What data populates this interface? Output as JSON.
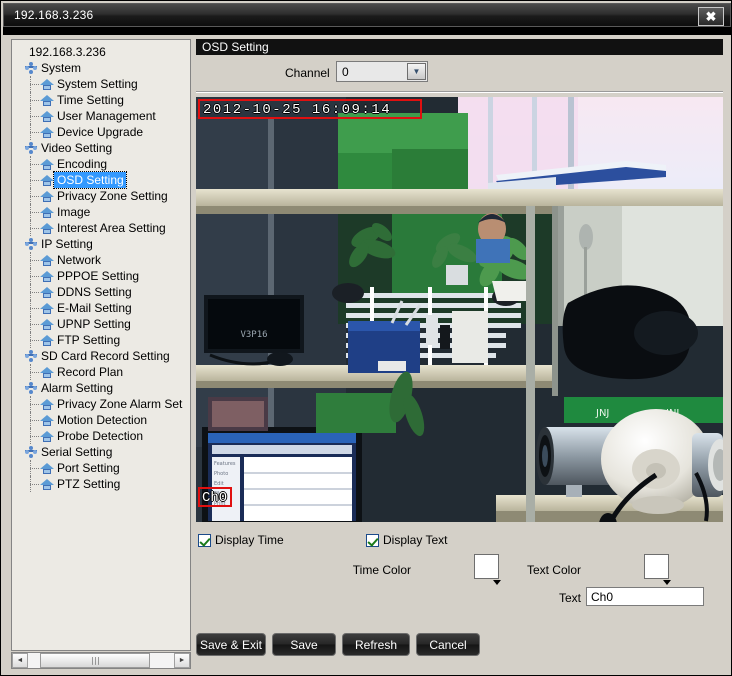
{
  "window": {
    "title": "192.168.3.236",
    "close_label": "✖"
  },
  "tree": {
    "root_label": "192.168.3.236",
    "nodes": [
      {
        "label": "System",
        "level": 1,
        "type": "group"
      },
      {
        "label": "System Setting",
        "level": 2,
        "type": "item"
      },
      {
        "label": "Time Setting",
        "level": 2,
        "type": "item"
      },
      {
        "label": "User Management",
        "level": 2,
        "type": "item"
      },
      {
        "label": "Device Upgrade",
        "level": 2,
        "type": "item"
      },
      {
        "label": "Video Setting",
        "level": 1,
        "type": "group"
      },
      {
        "label": "Encoding",
        "level": 2,
        "type": "item"
      },
      {
        "label": "OSD Setting",
        "level": 2,
        "type": "item",
        "selected": true
      },
      {
        "label": "Privacy Zone Setting",
        "level": 2,
        "type": "item"
      },
      {
        "label": "Image",
        "level": 2,
        "type": "item"
      },
      {
        "label": "Interest Area Setting",
        "level": 2,
        "type": "item"
      },
      {
        "label": "IP Setting",
        "level": 1,
        "type": "group"
      },
      {
        "label": "Network",
        "level": 2,
        "type": "item"
      },
      {
        "label": "PPPOE Setting",
        "level": 2,
        "type": "item"
      },
      {
        "label": "DDNS Setting",
        "level": 2,
        "type": "item"
      },
      {
        "label": "E-Mail Setting",
        "level": 2,
        "type": "item"
      },
      {
        "label": "UPNP Setting",
        "level": 2,
        "type": "item"
      },
      {
        "label": "FTP Setting",
        "level": 2,
        "type": "item"
      },
      {
        "label": "SD Card Record Setting",
        "level": 1,
        "type": "group"
      },
      {
        "label": "Record Plan",
        "level": 2,
        "type": "item"
      },
      {
        "label": "Alarm Setting",
        "level": 1,
        "type": "group"
      },
      {
        "label": "Privacy Zone Alarm Set",
        "level": 2,
        "type": "item"
      },
      {
        "label": "Motion Detection",
        "level": 2,
        "type": "item"
      },
      {
        "label": "Probe Detection",
        "level": 2,
        "type": "item"
      },
      {
        "label": "Serial Setting",
        "level": 1,
        "type": "group"
      },
      {
        "label": "Port Setting",
        "level": 2,
        "type": "item"
      },
      {
        "label": "PTZ Setting",
        "level": 2,
        "type": "item"
      }
    ],
    "scroll": {
      "left_arrow": "◄",
      "right_arrow": "►",
      "grip": "∣∣∣"
    }
  },
  "panel": {
    "section_title": "OSD Setting",
    "channel_label": "Channel",
    "channel_value": "0",
    "channel_arrow": "▼"
  },
  "video": {
    "osd_time_text": "2012-10-25 16:09:14",
    "osd_channel_text": "Ch0",
    "selection_color": "#e01010"
  },
  "options": {
    "display_time_label": "Display Time",
    "display_time_checked": true,
    "time_color_label": "Time Color",
    "time_color_value": "#ffffff",
    "display_text_label": "Display Text",
    "display_text_checked": true,
    "text_color_label": "Text Color",
    "text_color_value": "#ffffff",
    "text_label": "Text",
    "text_value": "Ch0"
  },
  "buttons": {
    "save_exit": "Save & Exit",
    "save": "Save",
    "refresh": "Refresh",
    "cancel": "Cancel"
  }
}
